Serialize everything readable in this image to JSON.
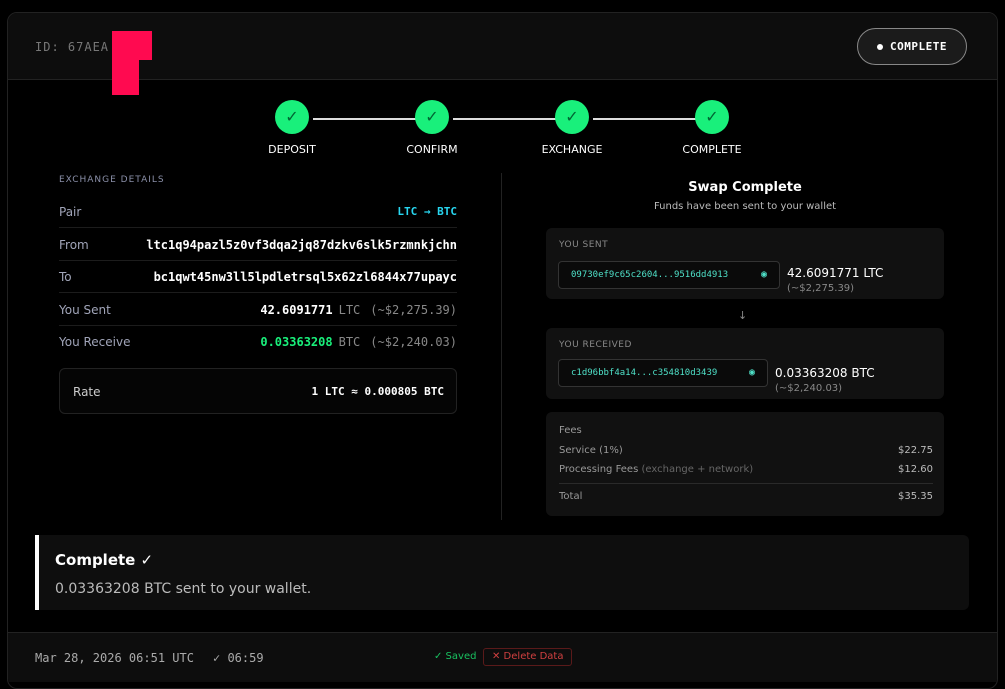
{
  "header": {
    "id_label": "ID: 67AEA",
    "status_label": "COMPLETE"
  },
  "steps": [
    {
      "label": "DEPOSIT",
      "check": "✓"
    },
    {
      "label": "CONFIRM",
      "check": "✓"
    },
    {
      "label": "EXCHANGE",
      "check": "✓"
    },
    {
      "label": "COMPLETE",
      "check": "✓"
    }
  ],
  "details": {
    "title": "EXCHANGE DETAILS",
    "pair_label": "Pair",
    "pair_value": "LTC → BTC",
    "from_label": "From",
    "from_value": "ltc1q94pazl5z0vf3dqa2jq87dzkv6slk5rzmnkjchn",
    "to_label": "To",
    "to_value": "bc1qwt45nw3ll5lpdletrsql5x62zl6844x77upayc",
    "sent_label": "You Sent",
    "sent_amount": "42.6091771",
    "sent_unit": "LTC",
    "sent_usd": "(~$2,275.39)",
    "receive_label": "You Receive",
    "receive_amount": "0.03363208",
    "receive_unit": "BTC",
    "receive_usd": "(~$2,240.03)",
    "rate_label": "Rate",
    "rate_value": "1 LTC ≈ 0.000805 BTC"
  },
  "swap": {
    "title": "Swap Complete",
    "subtitle": "Funds have been sent to your wallet",
    "sent_label": "YOU SENT",
    "sent_tx": "09730ef9c65c2604...9516dd4913",
    "sent_amount": "42.6091771 LTC",
    "sent_usd": "(~$2,275.39)",
    "arrow": "↓",
    "received_label": "YOU RECEIVED",
    "received_tx": "c1d96bbf4a14...c354810d3439",
    "received_amount": "0.03363208 BTC",
    "received_usd": "(~$2,240.03)",
    "eye_icon": "◉"
  },
  "fees": {
    "title": "Fees",
    "service_label": "Service (1%)",
    "service_value": "$22.75",
    "processing_label": "Processing Fees",
    "processing_note": "(exchange + network)",
    "processing_value": "$12.60",
    "total_label": "Total",
    "total_value": "$35.35"
  },
  "banner": {
    "title": "Complete ✓",
    "message": "0.03363208 BTC sent to your wallet."
  },
  "footer": {
    "date": "Mar 28, 2026 06:51 UTC",
    "completed": "✓ 06:59",
    "saved": "✓ Saved",
    "delete": "✕ Delete Data"
  },
  "colors": {
    "accent_green": "#19f07b",
    "pair_cyan": "#28d6f0",
    "tx_teal": "#4fe0c8",
    "delete_red": "#d04040"
  }
}
